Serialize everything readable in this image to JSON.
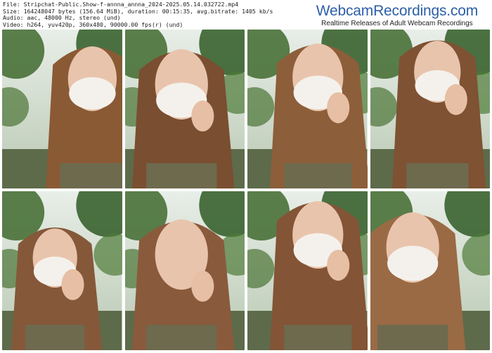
{
  "info": {
    "file": "File: Stripchat-Public.Show-f-annna_annna_2024-2025.05.14.032722.mp4",
    "size": "Size: 164248047 bytes (156.64 MiB), duration: 00:15:35, avg.bitrate: 1405 kb/s",
    "audio": "Audio: aac, 48000 Hz, stereo (und)",
    "video": "Video: h264, yuv420p, 360x480, 90000.00 fps(r) (und)"
  },
  "brand": {
    "title": "WebcamRecordings.com",
    "tagline": "Realtime Releases of Adult Webcam Recordings"
  },
  "thumbnails": [
    {
      "name": "frame-1",
      "hair": "#8a5a35",
      "mask": true,
      "hand": false
    },
    {
      "name": "frame-2",
      "hair": "#7a4e30",
      "mask": true,
      "hand": true
    },
    {
      "name": "frame-3",
      "hair": "#8d5e3a",
      "mask": true,
      "hand": true
    },
    {
      "name": "frame-4",
      "hair": "#7e5233",
      "mask": true,
      "hand": true
    },
    {
      "name": "frame-5",
      "hair": "#85583a",
      "mask": true,
      "hand": true
    },
    {
      "name": "frame-6",
      "hair": "#8a5a3c",
      "mask": false,
      "hand": true
    },
    {
      "name": "frame-7",
      "hair": "#835436",
      "mask": true,
      "hand": true
    },
    {
      "name": "frame-8",
      "hair": "#9a6a45",
      "mask": true,
      "hand": false
    }
  ]
}
